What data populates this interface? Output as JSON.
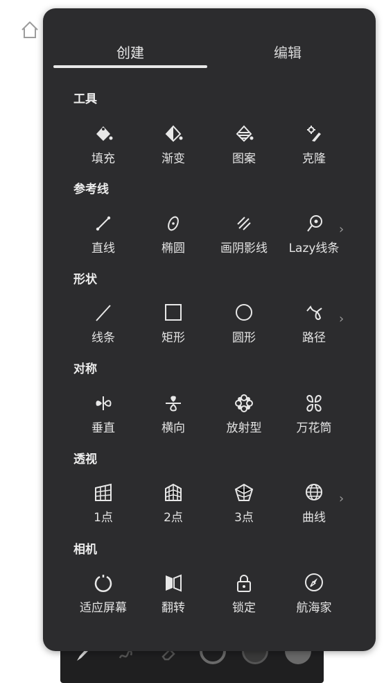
{
  "tabs": [
    {
      "label": "创建",
      "active": true
    },
    {
      "label": "编辑",
      "active": false
    }
  ],
  "sections": [
    {
      "title": "工具",
      "items": [
        "填充",
        "渐变",
        "图案",
        "克隆"
      ]
    },
    {
      "title": "参考线",
      "items": [
        "直线",
        "椭圆",
        "画阴影线",
        "Lazy线条"
      ],
      "has_more": true
    },
    {
      "title": "形状",
      "items": [
        "线条",
        "矩形",
        "圆形",
        "路径"
      ],
      "has_more": true
    },
    {
      "title": "对称",
      "items": [
        "垂直",
        "横向",
        "放射型",
        "万花筒"
      ]
    },
    {
      "title": "透视",
      "items": [
        "1点",
        "2点",
        "3点",
        "曲线"
      ],
      "has_more": true
    },
    {
      "title": "相机",
      "items": [
        "适应屏幕",
        "翻转",
        "锁定",
        "航海家"
      ]
    }
  ],
  "more_glyph": "›",
  "colors": {
    "panel_bg": "#2c2c2e",
    "text": "#e4e4e4",
    "toolbar_bg": "#1f1f20"
  }
}
